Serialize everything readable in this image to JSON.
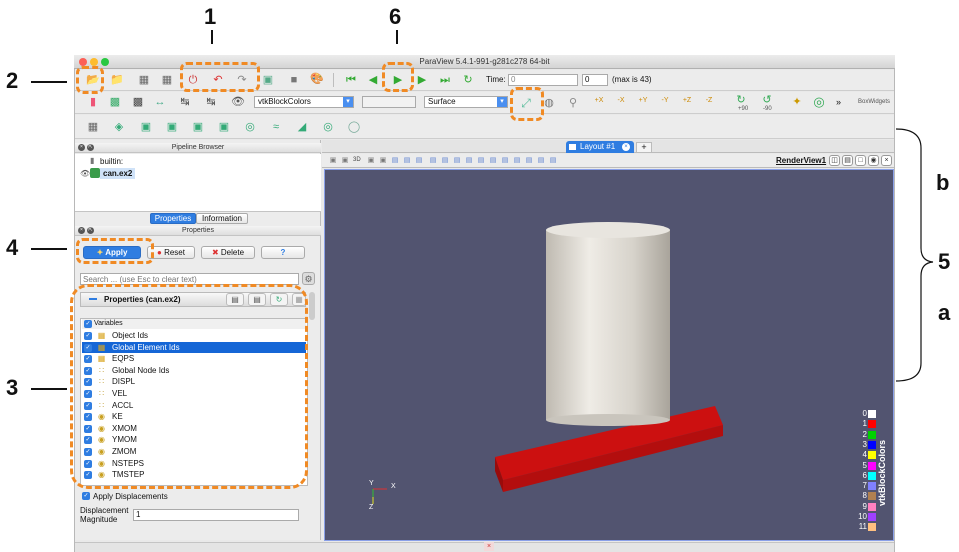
{
  "window": {
    "title": "ParaView 5.4.1-991-g281c278 64-bit"
  },
  "annotations": {
    "n1": "1",
    "n2": "2",
    "n3": "3",
    "n4": "4",
    "n5": "5",
    "n6": "6",
    "a": "a",
    "b": "b"
  },
  "toolbar1": {
    "time_label": "Time:",
    "time_value": "0",
    "timestep_value": "0",
    "max_label": "(max is 43)"
  },
  "toolbar2": {
    "color_by": "vtkBlockColors",
    "component": "",
    "representation": "Surface",
    "rot_plus90": "+90",
    "rot_minus90": "-90",
    "overflow": "»",
    "sidelabel": "BoxWidgets",
    "view_buttons": [
      "+X",
      "-X",
      "+Y",
      "-Y",
      "+Z",
      "-Z"
    ]
  },
  "pipeline_browser": {
    "title": "Pipeline Browser",
    "root": "builtin:",
    "item": "can.ex2"
  },
  "properties_panel": {
    "tab_properties": "Properties",
    "tab_information": "Information",
    "title": "Properties",
    "apply": "Apply",
    "reset": "Reset",
    "delete": "Delete",
    "help": "?",
    "search_placeholder": "Search ... (use Esc to clear text)",
    "section_title": "Properties (can.ex2)",
    "variables_header": "Variables",
    "variables": [
      {
        "name": "Object Ids",
        "icon": "cell-icon"
      },
      {
        "name": "Global Element Ids",
        "icon": "cell-icon"
      },
      {
        "name": "EQPS",
        "icon": "cell-icon"
      },
      {
        "name": "Global Node Ids",
        "icon": "point-icon"
      },
      {
        "name": "DISPL",
        "icon": "point-icon"
      },
      {
        "name": "VEL",
        "icon": "point-icon"
      },
      {
        "name": "ACCL",
        "icon": "point-icon"
      },
      {
        "name": "KE",
        "icon": "field-icon"
      },
      {
        "name": "XMOM",
        "icon": "field-icon"
      },
      {
        "name": "YMOM",
        "icon": "field-icon"
      },
      {
        "name": "ZMOM",
        "icon": "field-icon"
      },
      {
        "name": "NSTEPS",
        "icon": "field-icon"
      },
      {
        "name": "TMSTEP",
        "icon": "field-icon"
      }
    ],
    "selected_variable_index": 1,
    "apply_displacements": "Apply Displacements",
    "displacement_label": "Displacement Magnitude",
    "displacement_value": "1"
  },
  "layout": {
    "tab_label": "Layout #1",
    "add_tab": "+",
    "view_name": "RenderView1",
    "view_toolbar_3d": "3D"
  },
  "render_view": {
    "background": "#525470",
    "axes": {
      "x": "X",
      "y": "Y",
      "z": "Z"
    },
    "legend_title": "vtkBlockColors",
    "legend": [
      {
        "label": "0",
        "color": "#ffffff"
      },
      {
        "label": "1",
        "color": "#ff0000"
      },
      {
        "label": "2",
        "color": "#00d000"
      },
      {
        "label": "3",
        "color": "#0000ff"
      },
      {
        "label": "4",
        "color": "#ffff00"
      },
      {
        "label": "5",
        "color": "#ff00ff"
      },
      {
        "label": "6",
        "color": "#00ffff"
      },
      {
        "label": "7",
        "color": "#8080ff"
      },
      {
        "label": "8",
        "color": "#b08050"
      },
      {
        "label": "9",
        "color": "#ff80c0"
      },
      {
        "label": "10",
        "color": "#a040ff"
      },
      {
        "label": "11",
        "color": "#ffc080"
      }
    ]
  },
  "colors": {
    "callout": "#f08a24",
    "accent": "#1566d6"
  }
}
